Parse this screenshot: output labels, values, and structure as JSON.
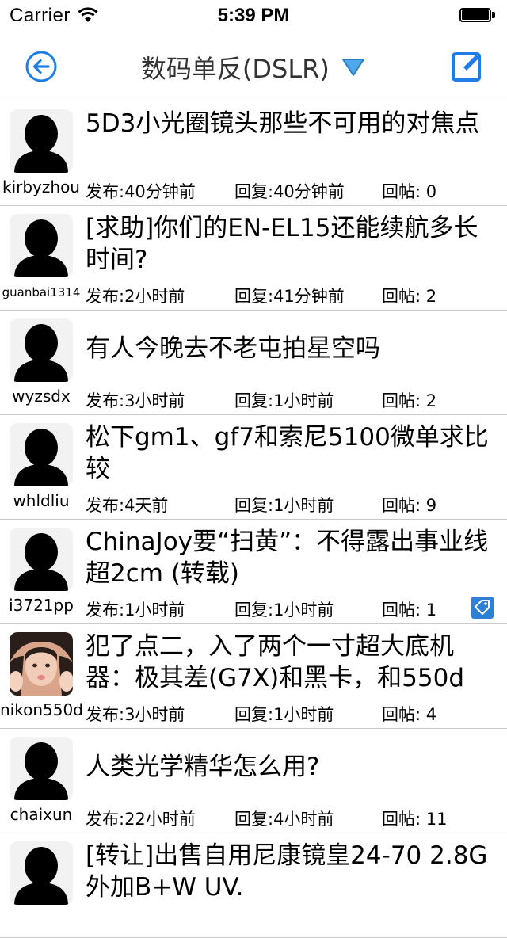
{
  "status_bar": {
    "carrier": "Carrier",
    "time": "5:39 PM",
    "icons": [
      "wifi-icon",
      "battery-icon"
    ]
  },
  "nav": {
    "title": "数码单反(DSLR)",
    "back_icon": "back-arrow-circle-icon",
    "dropdown_icon": "triangle-down-icon",
    "compose_icon": "compose-icon",
    "accent_color": "#1e7ee6"
  },
  "posts": [
    {
      "user": "kirbyzhou",
      "title": "5D3小光圈镜头那些不可用的对焦点",
      "posted": "发布:40分钟前",
      "replied": "回复:40分钟前",
      "count": "回帖: 0",
      "avatar": "default-silhouette"
    },
    {
      "user": "guanbai1314",
      "title": "[求助]你们的EN-EL15还能续航多长时间?",
      "posted": "发布:2小时前",
      "replied": "回复:41分钟前",
      "count": "回帖: 2",
      "avatar": "default-silhouette"
    },
    {
      "user": "wyzsdx",
      "title": "有人今晚去不老屯拍星空吗",
      "posted": "发布:3小时前",
      "replied": "回复:1小时前",
      "count": "回帖: 2",
      "avatar": "default-silhouette"
    },
    {
      "user": "whldliu",
      "title": "松下gm1、gf7和索尼5100微单求比较",
      "posted": "发布:4天前",
      "replied": "回复:1小时前",
      "count": "回帖: 9",
      "avatar": "default-silhouette"
    },
    {
      "user": "i3721pp",
      "title": "ChinaJoy要“扫黄”：不得露出事业线超2cm (转载)",
      "posted": "发布:1小时前",
      "replied": "回复:1小时前",
      "count": "回帖: 1",
      "avatar": "default-silhouette",
      "tag_icon": "tag-icon"
    },
    {
      "user": "nikon550d",
      "title": "犯了点二，入了两个一寸超大底机器：极其差(G7X)和黑卡，和550d",
      "posted": "发布:3小时前",
      "replied": "回复:1小时前",
      "count": "回帖: 4",
      "avatar": "user-photo"
    },
    {
      "user": "chaixun",
      "title": "人类光学精华怎么用?",
      "posted": "发布:22小时前",
      "replied": "回复:4小时前",
      "count": "回帖: 11",
      "avatar": "default-silhouette"
    },
    {
      "user": "",
      "title": "[转让]出售自用尼康镜皇24-70 2.8G外加B+W UV.",
      "posted": "",
      "replied": "",
      "count": "",
      "avatar": "default-silhouette"
    }
  ]
}
